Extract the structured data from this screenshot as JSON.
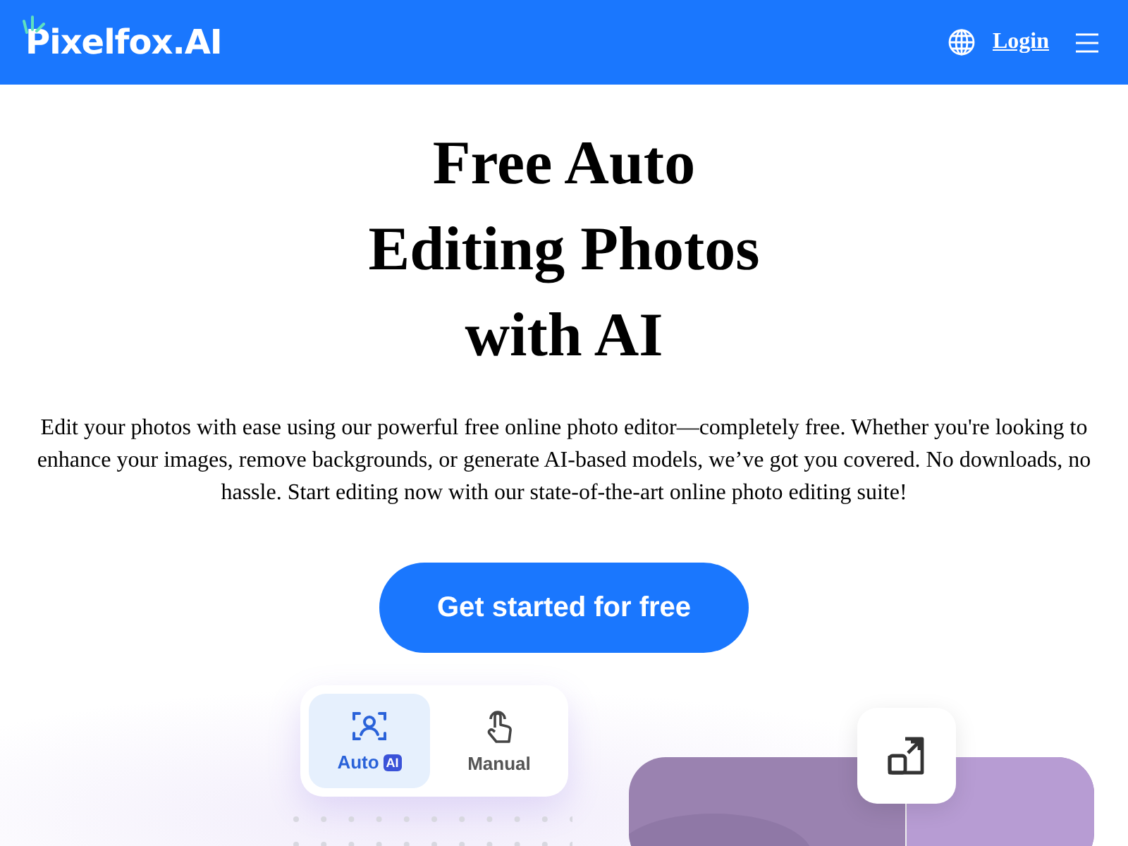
{
  "header": {
    "logo": "Pixelfox.AI",
    "login": "Login"
  },
  "hero": {
    "title_lines": [
      "Free Auto",
      "Editing Photos",
      "with AI"
    ],
    "description": "Edit your photos with ease using our powerful free online photo editor—completely free. Whether you're looking to enhance your images, remove backgrounds, or generate AI-based models, we’ve got you covered. No downloads, no hassle. Start editing now with our state-of-the-art online photo editing suite!",
    "cta": "Get started for free"
  },
  "demo": {
    "modes": [
      {
        "kind": "auto",
        "label": "Auto",
        "badge": "AI",
        "selected": true
      },
      {
        "kind": "manual",
        "label": "Manual",
        "selected": false
      }
    ]
  }
}
